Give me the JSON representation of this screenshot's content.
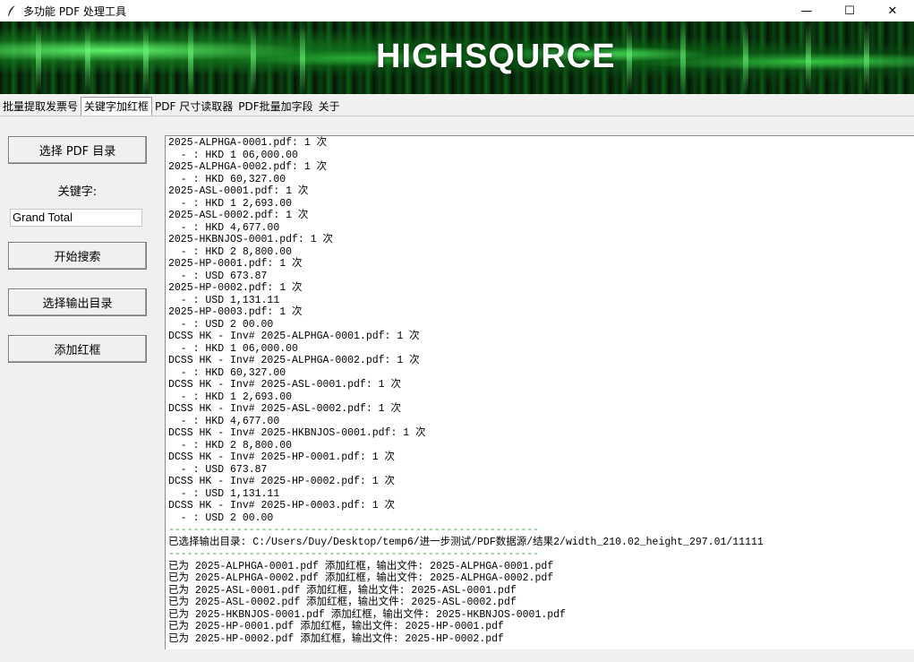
{
  "window": {
    "title": "多功能 PDF 处理工具",
    "icon": "feather-icon",
    "minimize": "—",
    "maximize": "☐",
    "close": "✕"
  },
  "banner": {
    "logo_text": "HIGHSQURCE"
  },
  "tabs": [
    {
      "label": "批量提取发票号",
      "active": false
    },
    {
      "label": "关键字加红框",
      "active": true
    },
    {
      "label": "PDF 尺寸读取器",
      "active": false
    },
    {
      "label": "PDF批量加字段",
      "active": false
    },
    {
      "label": "关于",
      "active": false
    }
  ],
  "controls": {
    "select_pdf_dir": "选择 PDF 目录",
    "keyword_label": "关键字:",
    "keyword_value": "Grand Total",
    "start_search": "开始搜索",
    "select_output_dir": "选择输出目录",
    "add_red_box": "添加红框"
  },
  "output_lines": [
    "2025-ALPHGA-0001.pdf: 1 次",
    "  - : HKD 1 06,000.00",
    "2025-ALPHGA-0002.pdf: 1 次",
    "  - : HKD 60,327.00",
    "2025-ASL-0001.pdf: 1 次",
    "  - : HKD 1 2,693.00",
    "2025-ASL-0002.pdf: 1 次",
    "  - : HKD 4,677.00",
    "2025-HKBNJOS-0001.pdf: 1 次",
    "  - : HKD 2 8,800.00",
    "2025-HP-0001.pdf: 1 次",
    "  - : USD 673.87",
    "2025-HP-0002.pdf: 1 次",
    "  - : USD 1,131.11",
    "2025-HP-0003.pdf: 1 次",
    "  - : USD 2 00.00",
    "DCSS HK - Inv# 2025-ALPHGA-0001.pdf: 1 次",
    "  - : HKD 1 06,000.00",
    "DCSS HK - Inv# 2025-ALPHGA-0002.pdf: 1 次",
    "  - : HKD 60,327.00",
    "DCSS HK - Inv# 2025-ASL-0001.pdf: 1 次",
    "  - : HKD 1 2,693.00",
    "DCSS HK - Inv# 2025-ASL-0002.pdf: 1 次",
    "  - : HKD 4,677.00",
    "DCSS HK - Inv# 2025-HKBNJOS-0001.pdf: 1 次",
    "  - : HKD 2 8,800.00",
    "DCSS HK - Inv# 2025-HP-0001.pdf: 1 次",
    "  - : USD 673.87",
    "DCSS HK - Inv# 2025-HP-0002.pdf: 1 次",
    "  - : USD 1,131.11",
    "DCSS HK - Inv# 2025-HP-0003.pdf: 1 次",
    "  - : USD 2 00.00",
    "------------------------------------------------------------",
    "已选择输出目录: C:/Users/Duy/Desktop/temp6/进一步测试/PDF数据源/结果2/width_210.02_height_297.01/11111",
    "------------------------------------------------------------",
    "已为 2025-ALPHGA-0001.pdf 添加红框，输出文件: 2025-ALPHGA-0001.pdf",
    "已为 2025-ALPHGA-0002.pdf 添加红框，输出文件: 2025-ALPHGA-0002.pdf",
    "已为 2025-ASL-0001.pdf 添加红框，输出文件: 2025-ASL-0001.pdf",
    "已为 2025-ASL-0002.pdf 添加红框，输出文件: 2025-ASL-0002.pdf",
    "已为 2025-HKBNJOS-0001.pdf 添加红框，输出文件: 2025-HKBNJOS-0001.pdf",
    "已为 2025-HP-0001.pdf 添加红框，输出文件: 2025-HP-0001.pdf",
    "已为 2025-HP-0002.pdf 添加红框，输出文件: 2025-HP-0002.pdf"
  ],
  "colors": {
    "separator": "#3aa14a",
    "window_bg": "#f0f0f0"
  }
}
